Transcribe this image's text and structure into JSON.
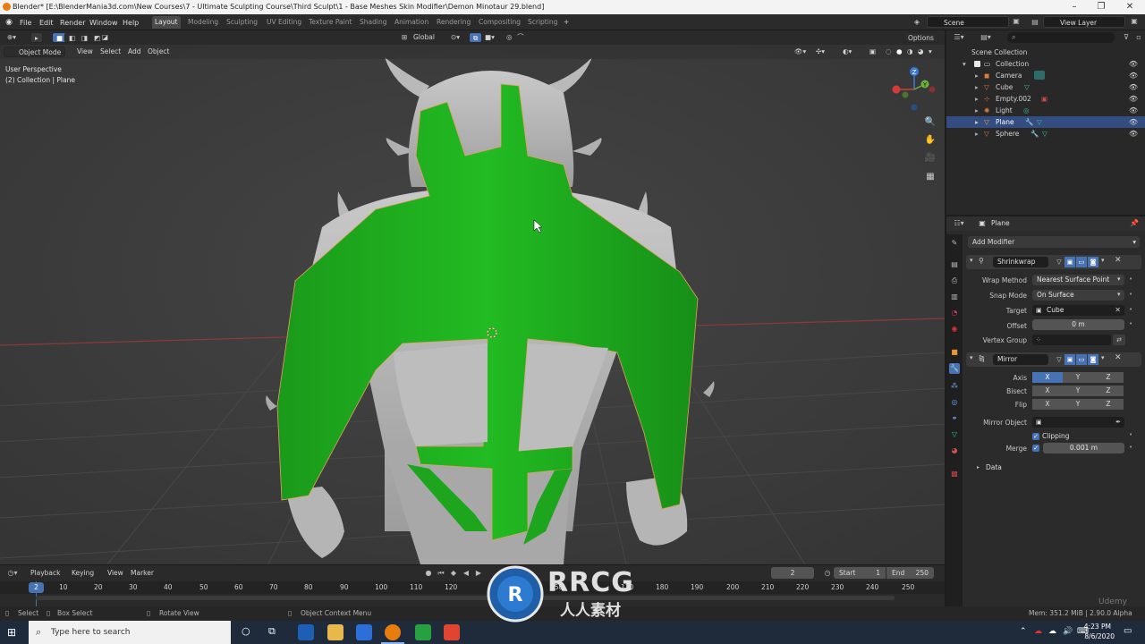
{
  "window": {
    "title": "Blender* [E:\\BlenderMania3d.com\\New Courses\\7 - Ultimate Sculpting Course\\Third Sculpt\\1 - Base Meshes Skin Modifier\\Demon Minotaur 29.blend]",
    "min": "–",
    "max": "❐",
    "close": "✕"
  },
  "menu": [
    "File",
    "Edit",
    "Render",
    "Window",
    "Help"
  ],
  "workspaces": [
    "Layout",
    "Modeling",
    "Sculpting",
    "UV Editing",
    "Texture Paint",
    "Shading",
    "Animation",
    "Rendering",
    "Compositing",
    "Scripting"
  ],
  "add_workspace": "+",
  "scene": "Scene",
  "view_layer": "View Layer",
  "header": {
    "orientation": "Global",
    "options": "Options",
    "mode": "Object Mode",
    "view": "View",
    "select": "Select",
    "add": "Add",
    "object": "Object"
  },
  "viewport": {
    "perspective": "User Perspective",
    "collection_info": "(2) Collection | Plane",
    "gizmo": {
      "x": "X",
      "y": "Y",
      "z": "Z"
    }
  },
  "outliner": {
    "root": "Scene Collection",
    "collection": "Collection",
    "items": [
      {
        "name": "Camera",
        "selected": false
      },
      {
        "name": "Cube",
        "selected": false
      },
      {
        "name": "Empty.002",
        "selected": false
      },
      {
        "name": "Light",
        "selected": false
      },
      {
        "name": "Plane",
        "selected": true
      },
      {
        "name": "Sphere",
        "selected": false
      }
    ]
  },
  "properties": {
    "object": "Plane",
    "add_modifier": "Add Modifier",
    "shrinkwrap": {
      "name": "Shrinkwrap",
      "wrap_method_label": "Wrap Method",
      "wrap_method": "Nearest Surface Point",
      "snap_mode_label": "Snap Mode",
      "snap_mode": "On Surface",
      "target_label": "Target",
      "target": "Cube",
      "offset_label": "Offset",
      "offset": "0 m",
      "vertex_group_label": "Vertex Group"
    },
    "mirror": {
      "name": "Mirror",
      "axis_label": "Axis",
      "bisect_label": "Bisect",
      "flip_label": "Flip",
      "axes": [
        "X",
        "Y",
        "Z"
      ],
      "mirror_object_label": "Mirror Object",
      "clipping": "Clipping",
      "merge_label": "Merge",
      "merge": "0.001 m",
      "data": "Data"
    }
  },
  "timeline": {
    "playback": "Playback",
    "keying": "Keying",
    "view": "View",
    "marker": "Marker",
    "current_frame": "2",
    "start_label": "Start",
    "start": "1",
    "end_label": "End",
    "end": "250",
    "ticks": [
      "2",
      "10",
      "20",
      "30",
      "40",
      "50",
      "60",
      "70",
      "80",
      "90",
      "100",
      "110",
      "120",
      "150",
      "170",
      "180",
      "190",
      "200",
      "210",
      "220",
      "230",
      "240",
      "250"
    ]
  },
  "status": {
    "select": "Select",
    "box_select": "Box Select",
    "rotate_view": "Rotate View",
    "context_menu": "Object Context Menu",
    "mem": "Mem: 351.2 MiB | 2.90.0 Alpha"
  },
  "taskbar": {
    "search_placeholder": "Type here to search",
    "time": "4:23 PM",
    "date": "8/6/2020"
  },
  "watermark": {
    "brand": "RRCG",
    "sub": "人人素材",
    "udemy": "Udemy"
  },
  "colors": {
    "accent": "#4772b3",
    "selection": "#334d80",
    "mesh_green": "#1fb21f",
    "viewport_bg": "#3d3d3d",
    "active_frame": "#4772b3"
  }
}
